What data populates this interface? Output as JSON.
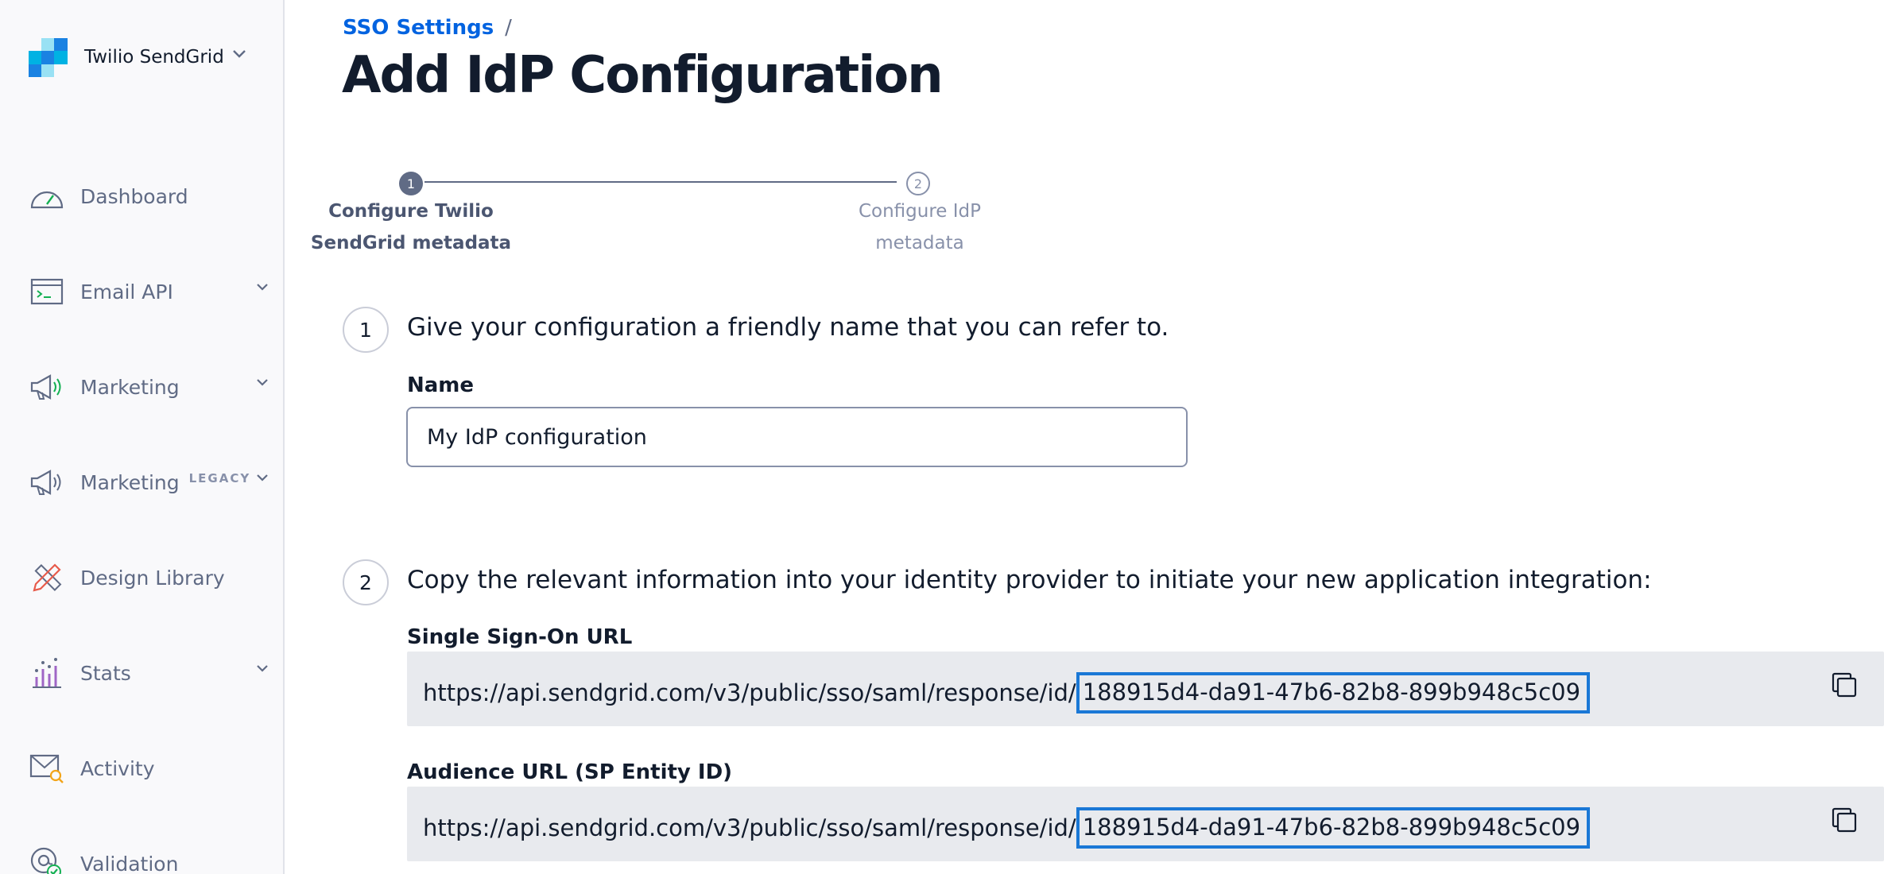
{
  "sidebar": {
    "brand": {
      "name": "Twilio SendGrid"
    },
    "items": [
      {
        "label": "Dashboard",
        "icon": "gauge-icon",
        "chevron": false
      },
      {
        "label": "Email API",
        "icon": "terminal-icon",
        "chevron": true
      },
      {
        "label": "Marketing",
        "icon": "megaphone-icon",
        "chevron": true
      },
      {
        "label": "Marketing",
        "badge": "LEGACY",
        "icon": "megaphone-icon",
        "chevron": true
      },
      {
        "label": "Design Library",
        "icon": "pencil-ruler-icon",
        "chevron": false
      },
      {
        "label": "Stats",
        "icon": "bar-chart-icon",
        "chevron": true
      },
      {
        "label": "Activity",
        "icon": "envelope-search-icon",
        "chevron": false
      },
      {
        "label": "Validation",
        "icon": "at-check-icon",
        "chevron": false
      }
    ]
  },
  "breadcrumb": {
    "link": "SSO Settings",
    "separator": "/"
  },
  "page": {
    "title": "Add IdP Configuration"
  },
  "progress": {
    "steps": [
      {
        "number": "1",
        "line1": "Configure Twilio",
        "line2": "SendGrid metadata",
        "state": "active"
      },
      {
        "number": "2",
        "line1": "Configure IdP",
        "line2": "metadata",
        "state": "inactive"
      }
    ]
  },
  "step1": {
    "number": "1",
    "text": "Give your configuration a friendly name that you can refer to.",
    "name_label": "Name",
    "name_value": "My IdP configuration"
  },
  "step2": {
    "number": "2",
    "text": "Copy the relevant information into your identity provider to initiate your new application integration:",
    "sso_url": {
      "label": "Single Sign-On URL",
      "prefix": "https://api.sendgrid.com/v3/public/sso/saml/response/id/",
      "id": "188915d4-da91-47b6-82b8-899b948c5c09"
    },
    "audience_url": {
      "label": "Audience URL (SP Entity ID)",
      "prefix": "https://api.sendgrid.com/v3/public/sso/saml/response/id/",
      "id": "188915d4-da91-47b6-82b8-899b948c5c09"
    }
  },
  "colors": {
    "link": "#0263e0",
    "highlight_border": "#1a78d6",
    "sidebar_bg": "#f9f9fb",
    "url_box_bg": "#e8eaee",
    "logo_dark": "#1a82e2",
    "logo_light": "#99e1f4"
  }
}
